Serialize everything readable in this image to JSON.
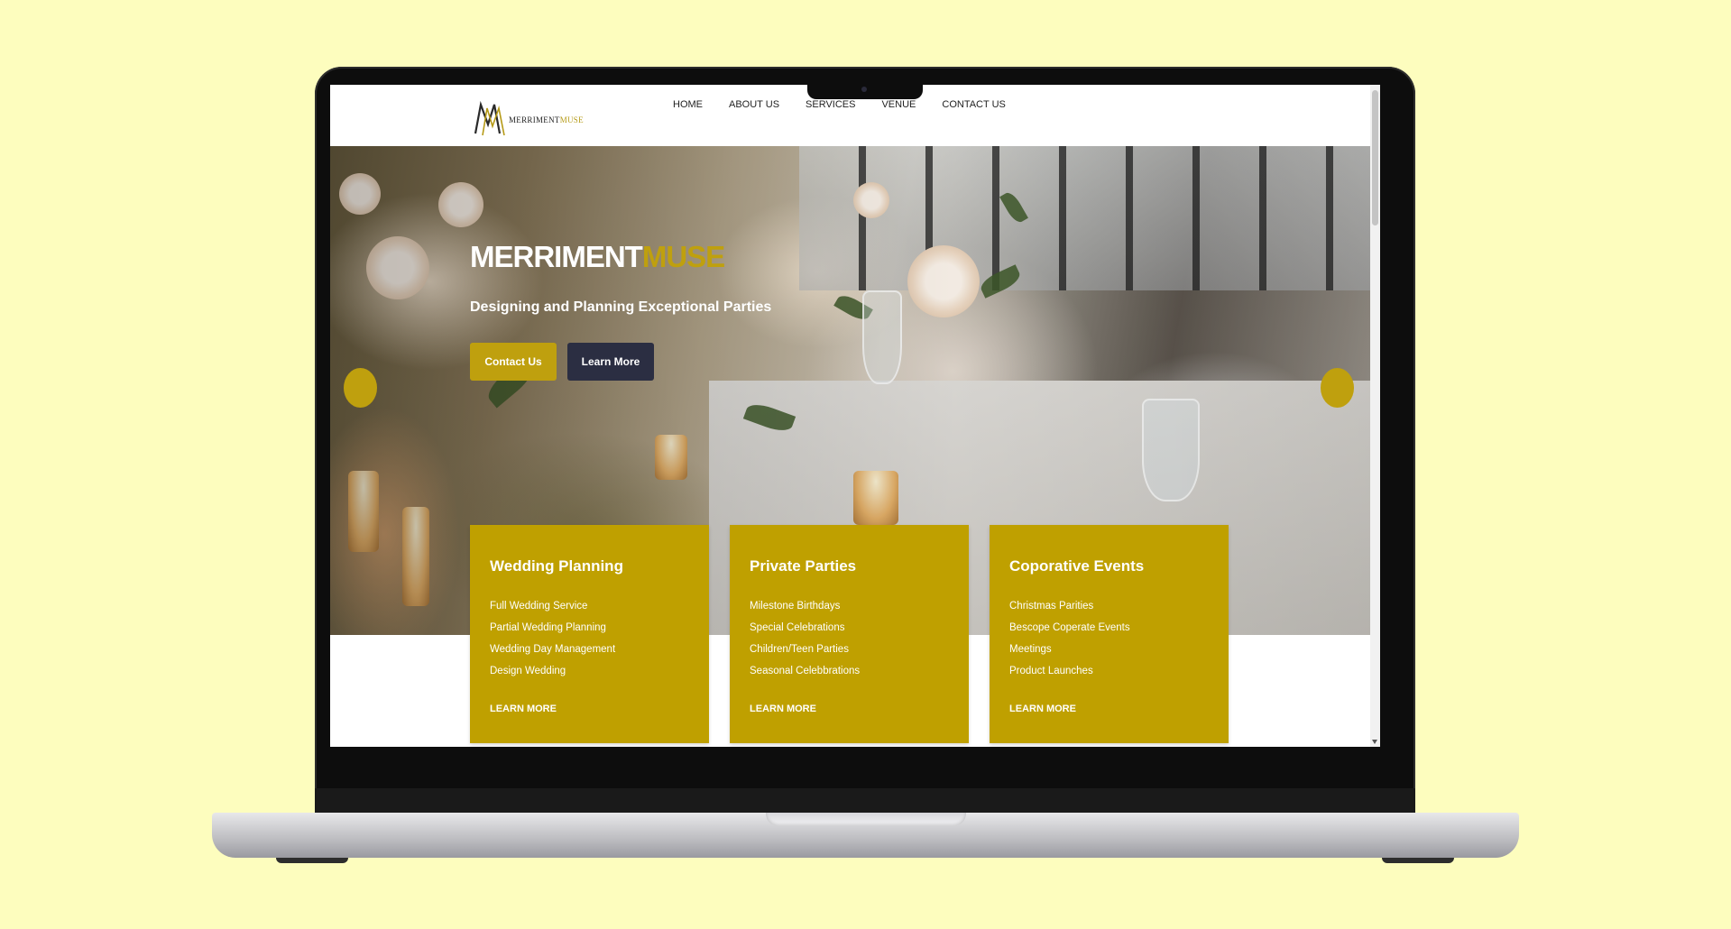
{
  "colors": {
    "background": "#fdfdbe",
    "accent": "#bfa00e",
    "dark_button": "#2b2e42",
    "card": "#bfa000"
  },
  "logo": {
    "name_primary": "MERRIMENT",
    "name_accent": "MUSE"
  },
  "nav": {
    "items": [
      "HOME",
      "ABOUT US",
      "SERVICES",
      "VENUE",
      "CONTACT US"
    ]
  },
  "hero": {
    "title_primary": "MERRIMENT",
    "title_accent": "MUSE",
    "subtitle": "Designing and Planning Exceptional Parties",
    "contact_button": "Contact Us",
    "learn_button": "Learn More"
  },
  "cards": [
    {
      "title": "Wedding Planning",
      "items": [
        "Full Wedding Service",
        "Partial Wedding Planning",
        "Wedding Day Management",
        "Design Wedding"
      ],
      "link": "LEARN MORE"
    },
    {
      "title": "Private Parties",
      "items": [
        "Milestone Birthdays",
        "Special Celebrations",
        "Children/Teen Parties",
        "Seasonal Celebbrations"
      ],
      "link": "LEARN MORE"
    },
    {
      "title": "Coporative Events",
      "items": [
        "Christmas Parities",
        "Bescope Coperate Events",
        "Meetings",
        "Product Launches"
      ],
      "link": "LEARN MORE"
    }
  ]
}
